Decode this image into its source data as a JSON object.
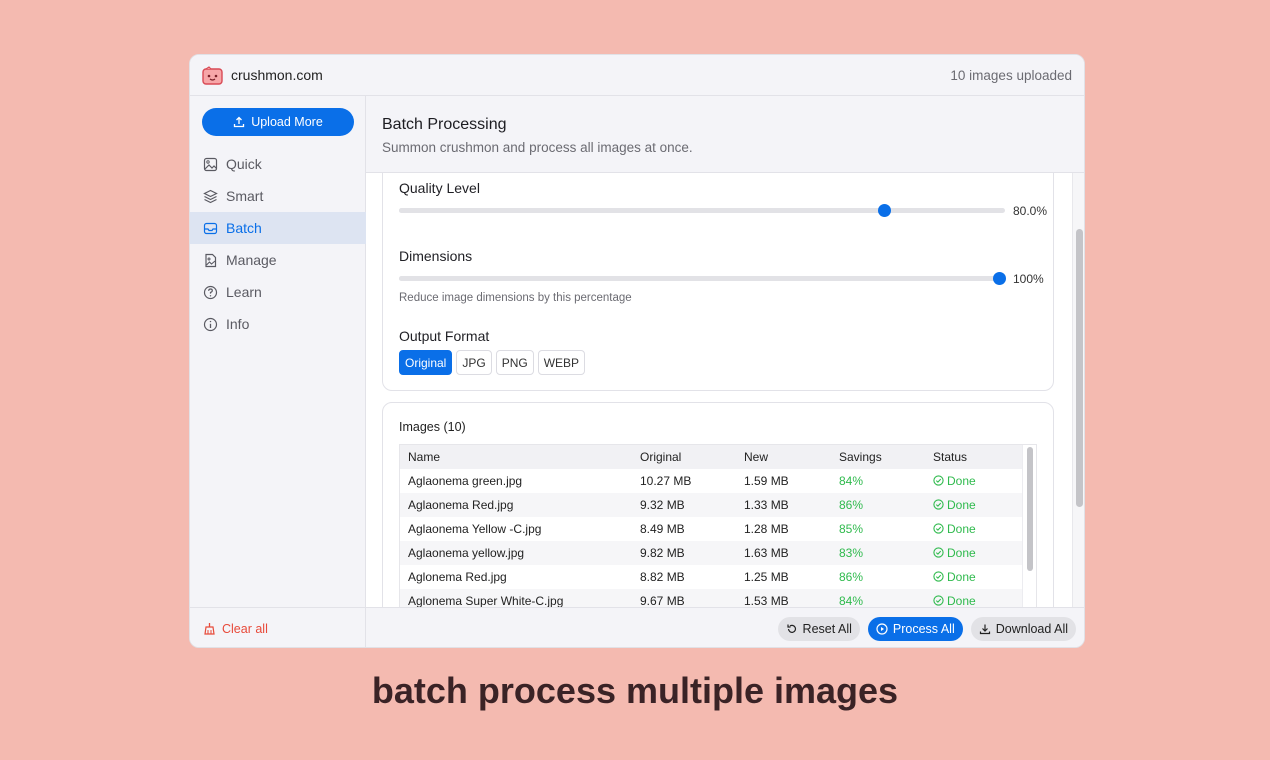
{
  "app": {
    "name": "crushmon.com",
    "upload_count": "10 images uploaded"
  },
  "sidebar": {
    "upload_label": "Upload More",
    "items": [
      {
        "label": "Quick",
        "icon": "image-icon"
      },
      {
        "label": "Smart",
        "icon": "layers-icon"
      },
      {
        "label": "Batch",
        "icon": "inbox-icon",
        "active": true
      },
      {
        "label": "Manage",
        "icon": "file-image-icon"
      },
      {
        "label": "Learn",
        "icon": "question-icon"
      },
      {
        "label": "Info",
        "icon": "info-icon"
      }
    ],
    "clear_label": "Clear all"
  },
  "header": {
    "title": "Batch Processing",
    "subtitle": "Summon crushmon and process all images at once."
  },
  "settings": {
    "quality": {
      "label": "Quality Level",
      "value_text": "80.0%",
      "value": 80
    },
    "dimensions": {
      "label": "Dimensions",
      "value_text": "100%",
      "value": 100,
      "hint": "Reduce image dimensions by this percentage"
    },
    "format": {
      "label": "Output Format",
      "options": [
        "Original",
        "JPG",
        "PNG",
        "WEBP"
      ],
      "selected": "Original"
    }
  },
  "images": {
    "title": "Images (10)",
    "columns": [
      "Name",
      "Original",
      "New",
      "Savings",
      "Status"
    ],
    "rows": [
      {
        "name": "Aglaonema green.jpg",
        "original": "10.27 MB",
        "new": "1.59 MB",
        "savings": "84%",
        "status": "Done"
      },
      {
        "name": "Aglaonema Red.jpg",
        "original": "9.32 MB",
        "new": "1.33 MB",
        "savings": "86%",
        "status": "Done"
      },
      {
        "name": "Aglaonema Yellow -C.jpg",
        "original": "8.49 MB",
        "new": "1.28 MB",
        "savings": "85%",
        "status": "Done"
      },
      {
        "name": "Aglaonema yellow.jpg",
        "original": "9.82 MB",
        "new": "1.63 MB",
        "savings": "83%",
        "status": "Done"
      },
      {
        "name": "Aglonema Red.jpg",
        "original": "8.82 MB",
        "new": "1.25 MB",
        "savings": "86%",
        "status": "Done"
      },
      {
        "name": "Aglonema Super White-C.jpg",
        "original": "9.67 MB",
        "new": "1.53 MB",
        "savings": "84%",
        "status": "Done"
      }
    ]
  },
  "footer": {
    "reset_label": "Reset All",
    "process_label": "Process All",
    "download_label": "Download All"
  },
  "caption": "batch process multiple images",
  "colors": {
    "accent": "#0a6fe8",
    "success": "#2fba4d",
    "danger": "#e84a3a",
    "background": "#f4bab0"
  }
}
